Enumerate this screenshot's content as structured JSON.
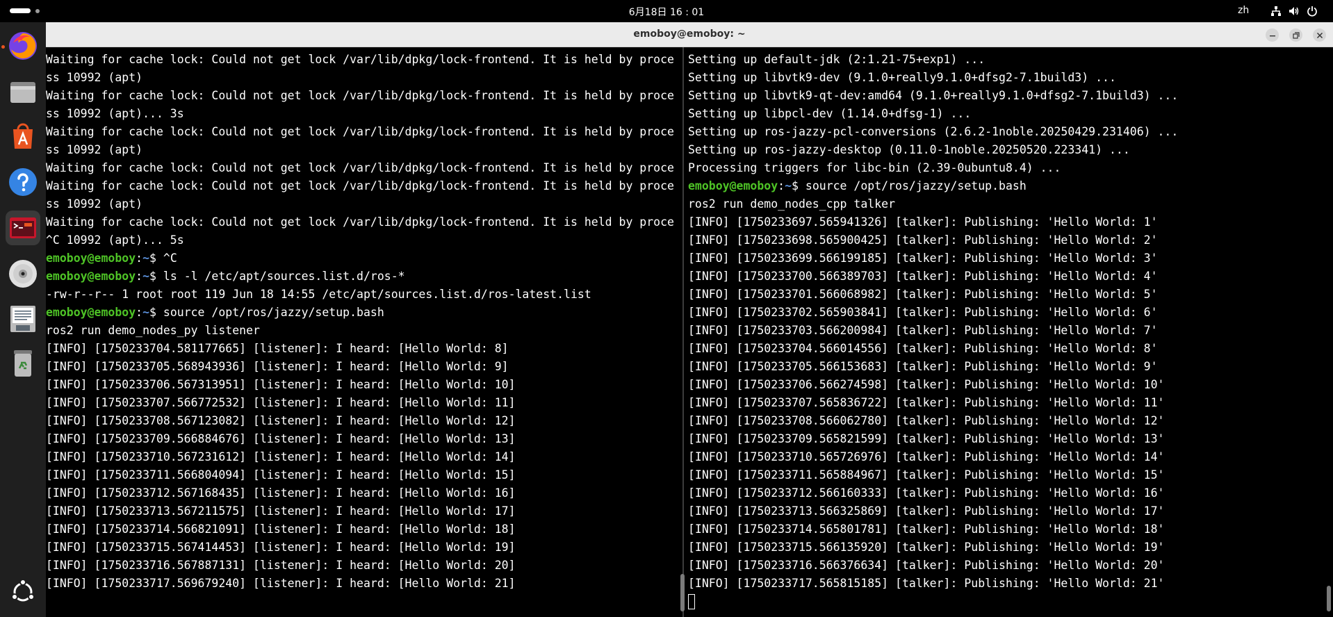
{
  "topbar": {
    "clock": "6月18日  16 : 01",
    "lang": "zh"
  },
  "dock": {
    "items": [
      {
        "name": "firefox",
        "icon": "firefox-icon"
      },
      {
        "name": "files",
        "icon": "folder-icon"
      },
      {
        "name": "app-center",
        "icon": "app-center-icon"
      },
      {
        "name": "help",
        "icon": "help-icon"
      },
      {
        "name": "terminal",
        "icon": "terminal-icon"
      },
      {
        "name": "dvd",
        "icon": "disc-icon"
      },
      {
        "name": "text-editor",
        "icon": "document-icon"
      },
      {
        "name": "trash",
        "icon": "trash-icon"
      }
    ],
    "show_apps": "ubuntu-icon"
  },
  "window": {
    "title": "emoboy@emoboy: ~"
  },
  "prompt": {
    "user": "emoboy@emoboy",
    "path": "~",
    "sep": ":",
    "symbol": "$ "
  },
  "left_terminal": {
    "lines": [
      {
        "type": "text",
        "text": "Waiting for cache lock: Could not get lock /var/lib/dpkg/lock-frontend. It is held by proce"
      },
      {
        "type": "text",
        "text": "ss 10992 (apt)"
      },
      {
        "type": "text",
        "text": "Waiting for cache lock: Could not get lock /var/lib/dpkg/lock-frontend. It is held by proce"
      },
      {
        "type": "text",
        "text": "ss 10992 (apt)... 3s"
      },
      {
        "type": "text",
        "text": "Waiting for cache lock: Could not get lock /var/lib/dpkg/lock-frontend. It is held by proce"
      },
      {
        "type": "text",
        "text": "ss 10992 (apt)"
      },
      {
        "type": "text",
        "text": "Waiting for cache lock: Could not get lock /var/lib/dpkg/lock-frontend. It is held by proce"
      },
      {
        "type": "text",
        "text": "Waiting for cache lock: Could not get lock /var/lib/dpkg/lock-frontend. It is held by proce"
      },
      {
        "type": "text",
        "text": "ss 10992 (apt)"
      },
      {
        "type": "text",
        "text": "Waiting for cache lock: Could not get lock /var/lib/dpkg/lock-frontend. It is held by proce"
      },
      {
        "type": "text",
        "text": "^C 10992 (apt)... 5s"
      },
      {
        "type": "prompt",
        "text": "^C"
      },
      {
        "type": "prompt",
        "text": "ls -l /etc/apt/sources.list.d/ros-*"
      },
      {
        "type": "text",
        "text": "-rw-r--r-- 1 root root 119 Jun 18 14:55 /etc/apt/sources.list.d/ros-latest.list"
      },
      {
        "type": "prompt",
        "text": "source /opt/ros/jazzy/setup.bash"
      },
      {
        "type": "text",
        "text": "ros2 run demo_nodes_py listener"
      },
      {
        "type": "text",
        "text": "[INFO] [1750233704.581177665] [listener]: I heard: [Hello World: 8]"
      },
      {
        "type": "text",
        "text": "[INFO] [1750233705.568943936] [listener]: I heard: [Hello World: 9]"
      },
      {
        "type": "text",
        "text": "[INFO] [1750233706.567313951] [listener]: I heard: [Hello World: 10]"
      },
      {
        "type": "text",
        "text": "[INFO] [1750233707.566772532] [listener]: I heard: [Hello World: 11]"
      },
      {
        "type": "text",
        "text": "[INFO] [1750233708.567123082] [listener]: I heard: [Hello World: 12]"
      },
      {
        "type": "text",
        "text": "[INFO] [1750233709.566884676] [listener]: I heard: [Hello World: 13]"
      },
      {
        "type": "text",
        "text": "[INFO] [1750233710.567231612] [listener]: I heard: [Hello World: 14]"
      },
      {
        "type": "text",
        "text": "[INFO] [1750233711.566804094] [listener]: I heard: [Hello World: 15]"
      },
      {
        "type": "text",
        "text": "[INFO] [1750233712.567168435] [listener]: I heard: [Hello World: 16]"
      },
      {
        "type": "text",
        "text": "[INFO] [1750233713.567211575] [listener]: I heard: [Hello World: 17]"
      },
      {
        "type": "text",
        "text": "[INFO] [1750233714.566821091] [listener]: I heard: [Hello World: 18]"
      },
      {
        "type": "text",
        "text": "[INFO] [1750233715.567414453] [listener]: I heard: [Hello World: 19]"
      },
      {
        "type": "text",
        "text": "[INFO] [1750233716.567887131] [listener]: I heard: [Hello World: 20]"
      },
      {
        "type": "text",
        "text": "[INFO] [1750233717.569679240] [listener]: I heard: [Hello World: 21]"
      }
    ]
  },
  "right_terminal": {
    "lines": [
      {
        "type": "text",
        "text": "Setting up default-jdk (2:1.21-75+exp1) ..."
      },
      {
        "type": "text",
        "text": "Setting up libvtk9-dev (9.1.0+really9.1.0+dfsg2-7.1build3) ..."
      },
      {
        "type": "text",
        "text": "Setting up libvtk9-qt-dev:amd64 (9.1.0+really9.1.0+dfsg2-7.1build3) ..."
      },
      {
        "type": "text",
        "text": "Setting up libpcl-dev (1.14.0+dfsg-1) ..."
      },
      {
        "type": "text",
        "text": "Setting up ros-jazzy-pcl-conversions (2.6.2-1noble.20250429.231406) ..."
      },
      {
        "type": "text",
        "text": "Setting up ros-jazzy-desktop (0.11.0-1noble.20250520.223341) ..."
      },
      {
        "type": "text",
        "text": "Processing triggers for libc-bin (2.39-0ubuntu8.4) ..."
      },
      {
        "type": "prompt",
        "text": "source /opt/ros/jazzy/setup.bash"
      },
      {
        "type": "text",
        "text": "ros2 run demo_nodes_cpp talker"
      },
      {
        "type": "text",
        "text": "[INFO] [1750233697.565941326] [talker]: Publishing: 'Hello World: 1'"
      },
      {
        "type": "text",
        "text": "[INFO] [1750233698.565900425] [talker]: Publishing: 'Hello World: 2'"
      },
      {
        "type": "text",
        "text": "[INFO] [1750233699.566199185] [talker]: Publishing: 'Hello World: 3'"
      },
      {
        "type": "text",
        "text": "[INFO] [1750233700.566389703] [talker]: Publishing: 'Hello World: 4'"
      },
      {
        "type": "text",
        "text": "[INFO] [1750233701.566068982] [talker]: Publishing: 'Hello World: 5'"
      },
      {
        "type": "text",
        "text": "[INFO] [1750233702.565903841] [talker]: Publishing: 'Hello World: 6'"
      },
      {
        "type": "text",
        "text": "[INFO] [1750233703.566200984] [talker]: Publishing: 'Hello World: 7'"
      },
      {
        "type": "text",
        "text": "[INFO] [1750233704.566014556] [talker]: Publishing: 'Hello World: 8'"
      },
      {
        "type": "text",
        "text": "[INFO] [1750233705.566153683] [talker]: Publishing: 'Hello World: 9'"
      },
      {
        "type": "text",
        "text": "[INFO] [1750233706.566274598] [talker]: Publishing: 'Hello World: 10'"
      },
      {
        "type": "text",
        "text": "[INFO] [1750233707.565836722] [talker]: Publishing: 'Hello World: 11'"
      },
      {
        "type": "text",
        "text": "[INFO] [1750233708.566062780] [talker]: Publishing: 'Hello World: 12'"
      },
      {
        "type": "text",
        "text": "[INFO] [1750233709.565821599] [talker]: Publishing: 'Hello World: 13'"
      },
      {
        "type": "text",
        "text": "[INFO] [1750233710.565726976] [talker]: Publishing: 'Hello World: 14'"
      },
      {
        "type": "text",
        "text": "[INFO] [1750233711.565884967] [talker]: Publishing: 'Hello World: 15'"
      },
      {
        "type": "text",
        "text": "[INFO] [1750233712.566160333] [talker]: Publishing: 'Hello World: 16'"
      },
      {
        "type": "text",
        "text": "[INFO] [1750233713.566325869] [talker]: Publishing: 'Hello World: 17'"
      },
      {
        "type": "text",
        "text": "[INFO] [1750233714.565801781] [talker]: Publishing: 'Hello World: 18'"
      },
      {
        "type": "text",
        "text": "[INFO] [1750233715.566135920] [talker]: Publishing: 'Hello World: 19'"
      },
      {
        "type": "text",
        "text": "[INFO] [1750233716.566376634] [talker]: Publishing: 'Hello World: 20'"
      },
      {
        "type": "text",
        "text": "[INFO] [1750233717.565815185] [talker]: Publishing: 'Hello World: 21'"
      }
    ],
    "has_cursor": true
  },
  "colors": {
    "prompt_user": "#4ec326",
    "prompt_path": "#5a8fd9",
    "terminal_bg": "#000000",
    "terminal_fg": "#ffffff",
    "titlebar_bg": "#ebebeb",
    "dock_bg": "#1f1f1f",
    "accent": "#e95420"
  }
}
